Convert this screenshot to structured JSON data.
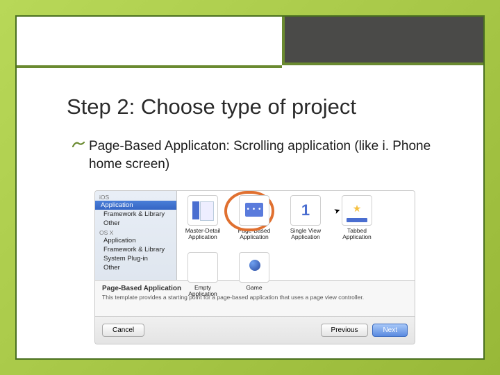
{
  "title": "Step 2: Choose type of project",
  "bullet": "Page-Based Applicaton: Scrolling application (like i. Phone home screen)",
  "dialog": {
    "sidebar": {
      "group1_header": "iOS",
      "group1": {
        "application": "Application",
        "framework": "Framework & Library",
        "other": "Other"
      },
      "group2_header": "OS X",
      "group2": {
        "application": "Application",
        "framework": "Framework & Library",
        "plugin": "System Plug-in",
        "other": "Other"
      }
    },
    "templates": {
      "master": "Master-Detail Application",
      "page": "Page-Based Application",
      "single": "Single View Application",
      "tabbed": "Tabbed Application",
      "empty": "Empty Application",
      "game": "Game"
    },
    "desc": {
      "title": "Page-Based Application",
      "text": "This template provides a starting point for a page-based application that uses a page view controller."
    },
    "buttons": {
      "cancel": "Cancel",
      "previous": "Previous",
      "next": "Next"
    }
  }
}
